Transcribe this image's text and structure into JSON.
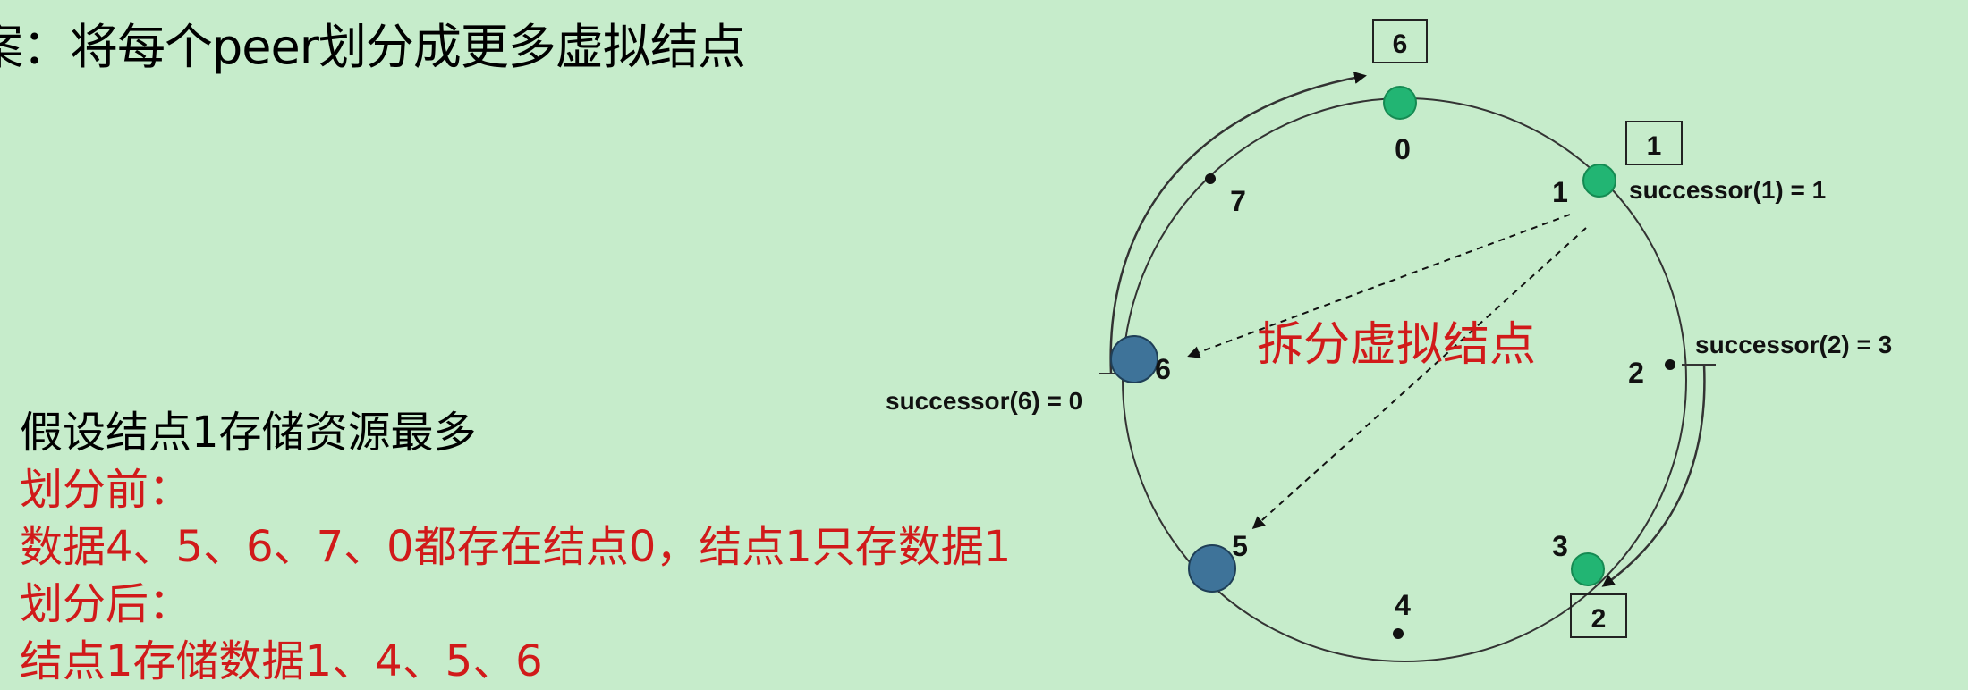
{
  "title": "案：将每个peer划分成更多虚拟结点",
  "description": {
    "line1": "假设结点1存储资源最多",
    "line2": "划分前：",
    "line3": "数据4、5、6、7、0都存在结点0，结点1只存数据1",
    "line4": "划分后：",
    "line5": "结点1存储数据1、4、5、6"
  },
  "diagram": {
    "split_label": "拆分虚拟结点",
    "positions": [
      "0",
      "1",
      "2",
      "3",
      "4",
      "5",
      "6",
      "7"
    ],
    "boxes": {
      "top": "6",
      "right": "1",
      "bottom": "2"
    },
    "successors": {
      "s1": "successor(1) = 1",
      "s2": "successor(2) = 3",
      "s6": "successor(6) = 0"
    },
    "colors": {
      "background": "#c6eccb",
      "real_node": "#22b573",
      "virtual_node": "#3e7399",
      "accent_red": "#d11a1a"
    }
  }
}
